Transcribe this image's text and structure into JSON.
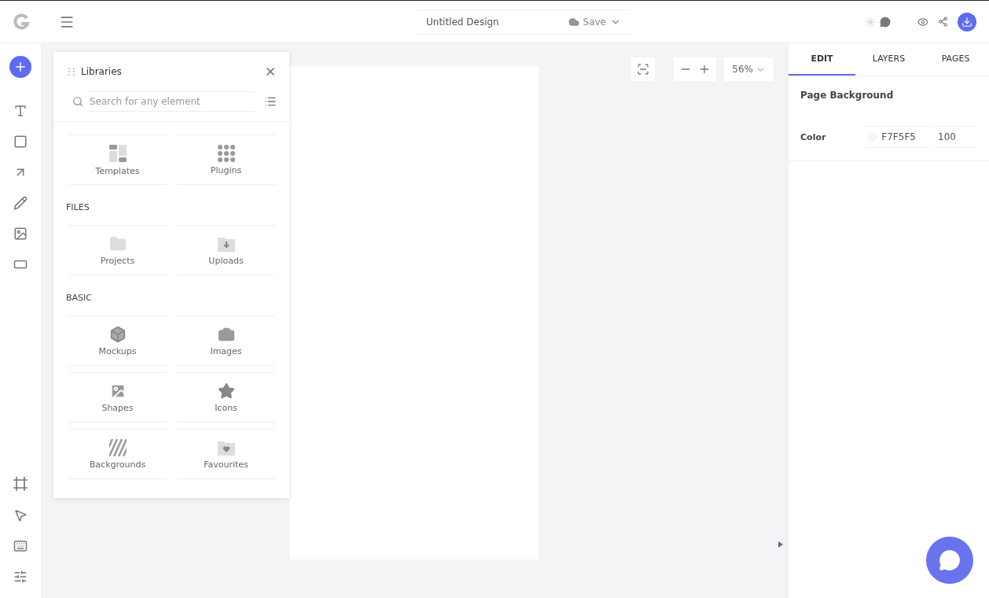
{
  "header": {
    "design_title": "Untitled Design",
    "save_label": "Save"
  },
  "libraries": {
    "title": "Libraries",
    "search": {
      "placeholder": "Search for any element"
    },
    "top_items": [
      {
        "label": "Templates",
        "kind": "templates"
      },
      {
        "label": "Plugins",
        "kind": "plugins"
      }
    ],
    "sections": [
      {
        "heading": "FILES",
        "items": [
          {
            "label": "Projects",
            "kind": "folder"
          },
          {
            "label": "Uploads",
            "kind": "upload"
          }
        ]
      },
      {
        "heading": "BASIC",
        "items": [
          {
            "label": "Mockups",
            "kind": "box"
          },
          {
            "label": "Images",
            "kind": "camera"
          },
          {
            "label": "Shapes",
            "kind": "picture"
          },
          {
            "label": "Icons",
            "kind": "star"
          },
          {
            "label": "Backgrounds",
            "kind": "stripes"
          },
          {
            "label": "Favourites",
            "kind": "heart"
          }
        ]
      }
    ]
  },
  "zoom": {
    "value": "56%"
  },
  "right_panel": {
    "tabs": [
      {
        "label": "EDIT",
        "selected": true
      },
      {
        "label": "LAYERS",
        "selected": false
      },
      {
        "label": "PAGES",
        "selected": false
      }
    ],
    "section_title": "Page Background",
    "color_label": "Color",
    "color_value": "F7F5F5",
    "opacity": "100"
  }
}
